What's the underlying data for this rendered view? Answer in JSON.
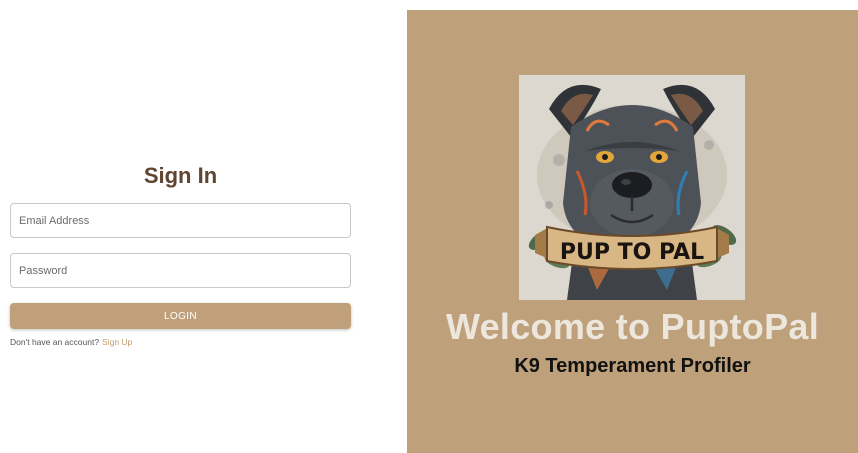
{
  "signin": {
    "title": "Sign In",
    "email_placeholder": "Email Address",
    "password_placeholder": "Password",
    "login_label": "LOGIN",
    "no_account_text": "Don't have an account?",
    "signup_link": "Sign Up"
  },
  "panel": {
    "logo_text": "PUP TO PAL",
    "welcome_title": "Welcome to PuptoPal",
    "subtitle": "K9 Temperament Profiler"
  },
  "colors": {
    "panel_bg": "#bea07b",
    "accent": "#c0a07a",
    "title": "#5e4630",
    "link": "#c29b6a"
  }
}
